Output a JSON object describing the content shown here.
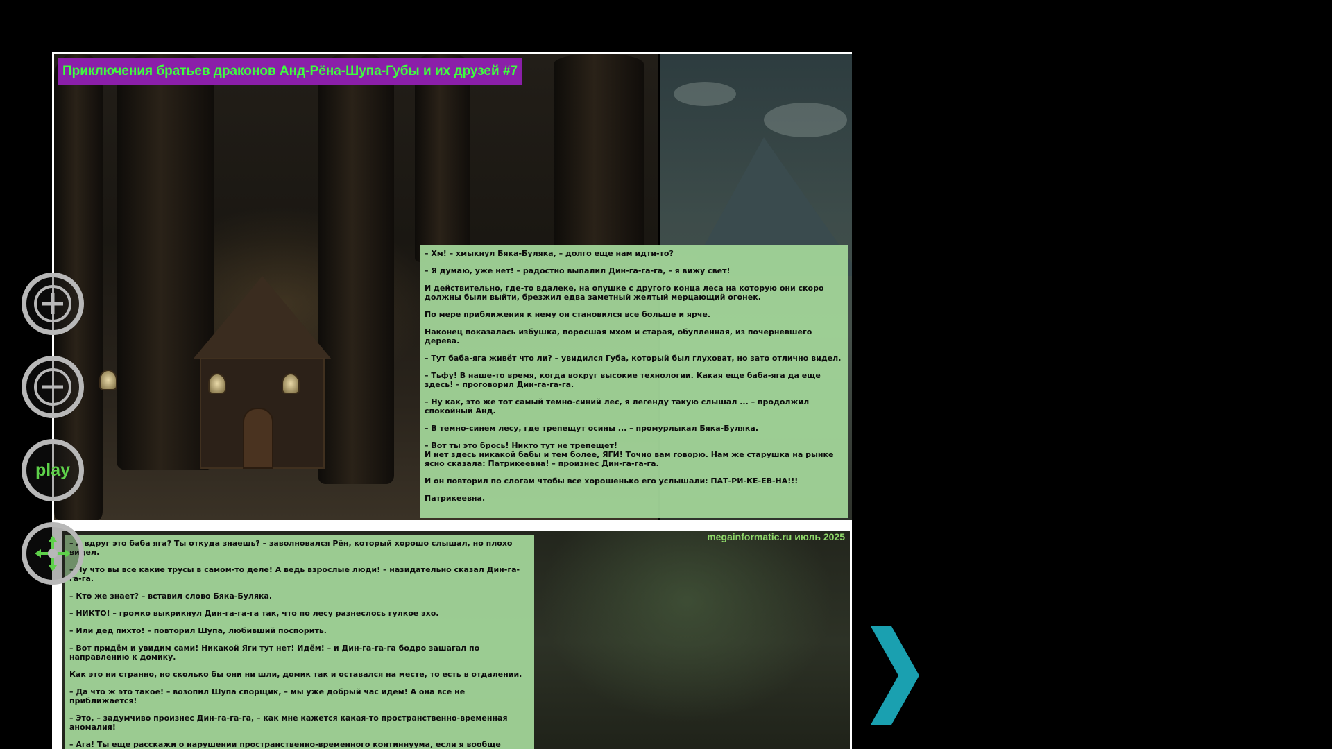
{
  "comic": {
    "title": "Приключения братьев драконов Анд-Рёна-Шупа-Губы и их друзей #7",
    "watermark": "megainformatic.ru июль 2025"
  },
  "top_box": {
    "paragraphs": [
      "– Хм! – хмыкнул Бяка-Буляка, – долго еще нам идти-то?",
      "– Я думаю, уже нет! – радостно выпалил Дин-га-га-га, – я вижу свет!",
      "И действительно, где-то вдалеке, на опушке с другого конца леса на которую они скоро должны были выйти, брезжил едва заметный желтый мерцающий огонек.",
      "По мере приближения к нему он становился все больше и ярче.",
      "Наконец показалась избушка, поросшая мхом и старая, обупленная, из почерневшего дерева.",
      "– Тут баба-яга живёт что ли? – увидился Губа, который был глуховат, но зато отлично видел.",
      "– Тьфу! В наше-то время, когда вокруг высокие технологии. Какая еще баба-яга да еще здесь! – проговорил Дин-га-га-га.",
      "– Ну как, это же тот самый темно-синий лес, я легенду такую слышал ... – продолжил спокойный Анд.",
      "– В темно-синем лесу, где трепещут осины ... – промурлыкал Бяка-Буляка.",
      "– Вот ты это брось! Никто тут не трепещет!\nИ нет здесь никакой бабы и тем более, ЯГИ! Точно вам говорю. Нам же старушка на рынке ясно сказала: Патрикеевна! – произнес Дин-га-га-га.",
      "И он повторил по слогам чтобы все хорошенько его услышали: ПАТ-РИ-КЕ-ЕВ-НА!!!",
      "Патрикеевна."
    ]
  },
  "bottom_box": {
    "paragraphs": [
      "– А вдруг это баба яга? Ты откуда знаешь? – заволновался Рён, который хорошо слышал, но плохо видел.",
      "– Ну что вы все какие трусы в самом-то деле! А ведь взрослые люди! – назидательно сказал Дин-га-га-га.",
      "– Кто же знает? – вставил слово Бяка-Буляка.",
      "– НИКТО! – громко выкрикнул Дин-га-га-га так, что по лесу разнеслось гулкое эхо.",
      "– Или дед пихто! – повторил Шупа, любивший поспорить.",
      "– Вот придём и увидим сами! Никакой Яги тут нет! Идём! – и Дин-га-га-га бодро зашагал по направлению к домику.",
      "Как это ни странно, но сколько бы они ни шли, домик так и оставался на месте, то есть в отдалении.",
      "– Да что ж это такое! – возопил Шупа спорщик, – мы уже добрый час идем! А она все не приближается!",
      "– Это, – задумчиво произнес Дин-га-га-га, – как мне кажется какая-то пространственно-временная аномалия!",
      "– Ага! Ты еще расскажи о нарушении пространственно-временного континнуума, если я вообще понимаю, о чём говорю – нервно произнес Шупа."
    ]
  },
  "controls": {
    "zoom_in_icon": "zoom-in-icon",
    "zoom_out_icon": "zoom-out-icon",
    "play_label": "play",
    "pan_icon": "pan-arrows-icon",
    "next_icon": "chevron-right-icon"
  },
  "colors": {
    "title_bg": "#8b1fa9",
    "title_text": "#3dff3d",
    "text_box_bg": "#a3d699",
    "accent_arrow": "#1aa0b0",
    "control_ring": "#b8b8b8",
    "play_text": "#5ed14a"
  }
}
